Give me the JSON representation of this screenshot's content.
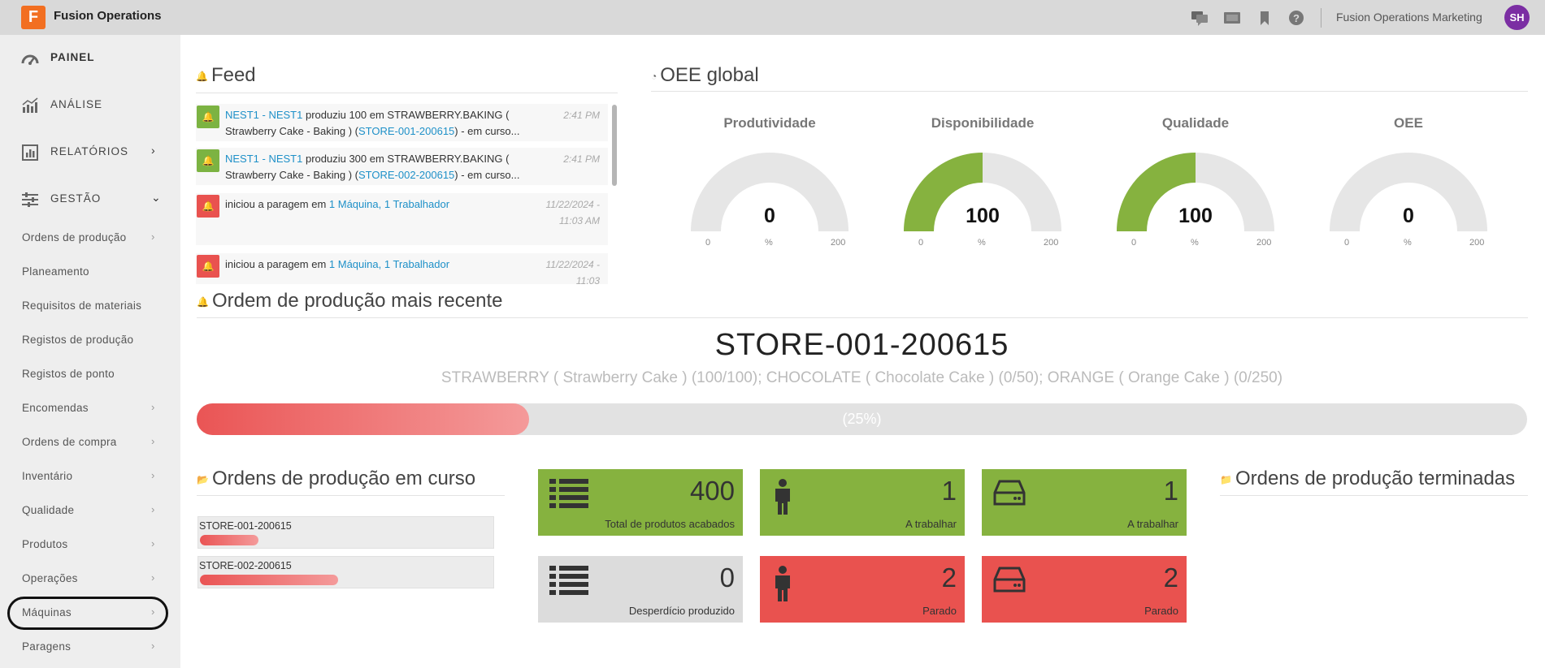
{
  "app": {
    "logo_letter": "F",
    "name": "Fusion Operations",
    "org": "Fusion Operations Marketing",
    "avatar_initials": "SH",
    "accent": "#f26f21",
    "avatar_color": "#7b2ea3"
  },
  "topbar_icons": [
    "chat-icon",
    "screen-icon",
    "bookmark-icon",
    "help-icon"
  ],
  "sidebar": {
    "main": [
      {
        "label": "PAINEL",
        "icon": "dashboard-icon"
      },
      {
        "label": "ANÁLISE",
        "icon": "analytics-icon"
      },
      {
        "label": "RELATÓRIOS",
        "icon": "reports-icon",
        "chevron": "›"
      },
      {
        "label": "GESTÃO",
        "icon": "sliders-icon",
        "chevron": "⌄"
      }
    ],
    "sub": [
      {
        "label": "Ordens de produção",
        "chevron": "›"
      },
      {
        "label": "Planeamento",
        "chevron": ""
      },
      {
        "label": "Requisitos de materiais",
        "chevron": ""
      },
      {
        "label": "Registos de produção",
        "chevron": ""
      },
      {
        "label": "Registos de ponto",
        "chevron": ""
      },
      {
        "label": "Encomendas",
        "chevron": "›"
      },
      {
        "label": "Ordens de compra",
        "chevron": "›"
      },
      {
        "label": "Inventário",
        "chevron": "›"
      },
      {
        "label": "Qualidade",
        "chevron": "›"
      },
      {
        "label": "Produtos",
        "chevron": "›"
      },
      {
        "label": "Operações",
        "chevron": "›"
      },
      {
        "label": "Máquinas",
        "chevron": "›"
      },
      {
        "label": "Paragens",
        "chevron": "›"
      }
    ]
  },
  "feed": {
    "title": "Feed",
    "items": [
      {
        "type": "production",
        "link1": "NEST1 - NEST1",
        "text1": " produziu 100 em STRAWBERRY.BAKING ( Strawberry Cake - Baking ) (",
        "link2": "STORE-001-200615",
        "text2": ") - em curso...",
        "time": "2:41 PM"
      },
      {
        "type": "production",
        "link1": "NEST1 - NEST1",
        "text1": " produziu 300 em STRAWBERRY.BAKING ( Strawberry Cake - Baking ) (",
        "link2": "STORE-002-200615",
        "text2": ") - em curso...",
        "time": "2:41 PM"
      },
      {
        "type": "stop",
        "text0": "iniciou a paragem em ",
        "link1": "1 Máquina, 1 Trabalhador",
        "time": "11/22/2024 - 11:03 AM"
      },
      {
        "type": "stop",
        "text0": "iniciou a paragem em ",
        "link1": "1 Máquina, 1 Trabalhador",
        "time": "11/22/2024 - 11:03"
      }
    ]
  },
  "oee": {
    "title": "OEE global",
    "gauges": [
      {
        "title": "Produtividade",
        "value": 0,
        "min": "0",
        "max": "200",
        "unit": "%"
      },
      {
        "title": "Disponibilidade",
        "value": 100,
        "min": "0",
        "max": "200",
        "unit": "%"
      },
      {
        "title": "Qualidade",
        "value": 100,
        "min": "0",
        "max": "200",
        "unit": "%"
      },
      {
        "title": "OEE",
        "value": 0,
        "min": "0",
        "max": "200",
        "unit": "%"
      }
    ]
  },
  "recent_order": {
    "title": "Ordem de produção mais recente",
    "code": "STORE-001-200615",
    "description": "STRAWBERRY ( Strawberry Cake ) (100/100); CHOCOLATE ( Chocolate Cake ) (0/50); ORANGE ( Orange Cake ) (0/250)",
    "progress": 0.25,
    "progress_label": "(25%)"
  },
  "in_progress": {
    "title": "Ordens de produção em curso",
    "orders": [
      {
        "code": "STORE-001-200615",
        "progress": 0.2
      },
      {
        "code": "STORE-002-200615",
        "progress": 0.47
      }
    ]
  },
  "tiles": [
    {
      "value": "400",
      "caption": "Total de produtos acabados",
      "icon": "list-icon",
      "color": "green"
    },
    {
      "value": "1",
      "caption": "A trabalhar",
      "icon": "person-icon",
      "color": "green"
    },
    {
      "value": "1",
      "caption": "A trabalhar",
      "icon": "machine-icon",
      "color": "green"
    },
    {
      "value": "0",
      "caption": "Desperdício produzido",
      "icon": "list-icon",
      "color": "grey"
    },
    {
      "value": "2",
      "caption": "Parado",
      "icon": "person-icon",
      "color": "red"
    },
    {
      "value": "2",
      "caption": "Parado",
      "icon": "machine-icon",
      "color": "red"
    }
  ],
  "finished": {
    "title": "Ordens de produção terminadas"
  },
  "colors": {
    "green": "#86b23f",
    "red": "#e9524f",
    "link": "#1e90c8"
  }
}
